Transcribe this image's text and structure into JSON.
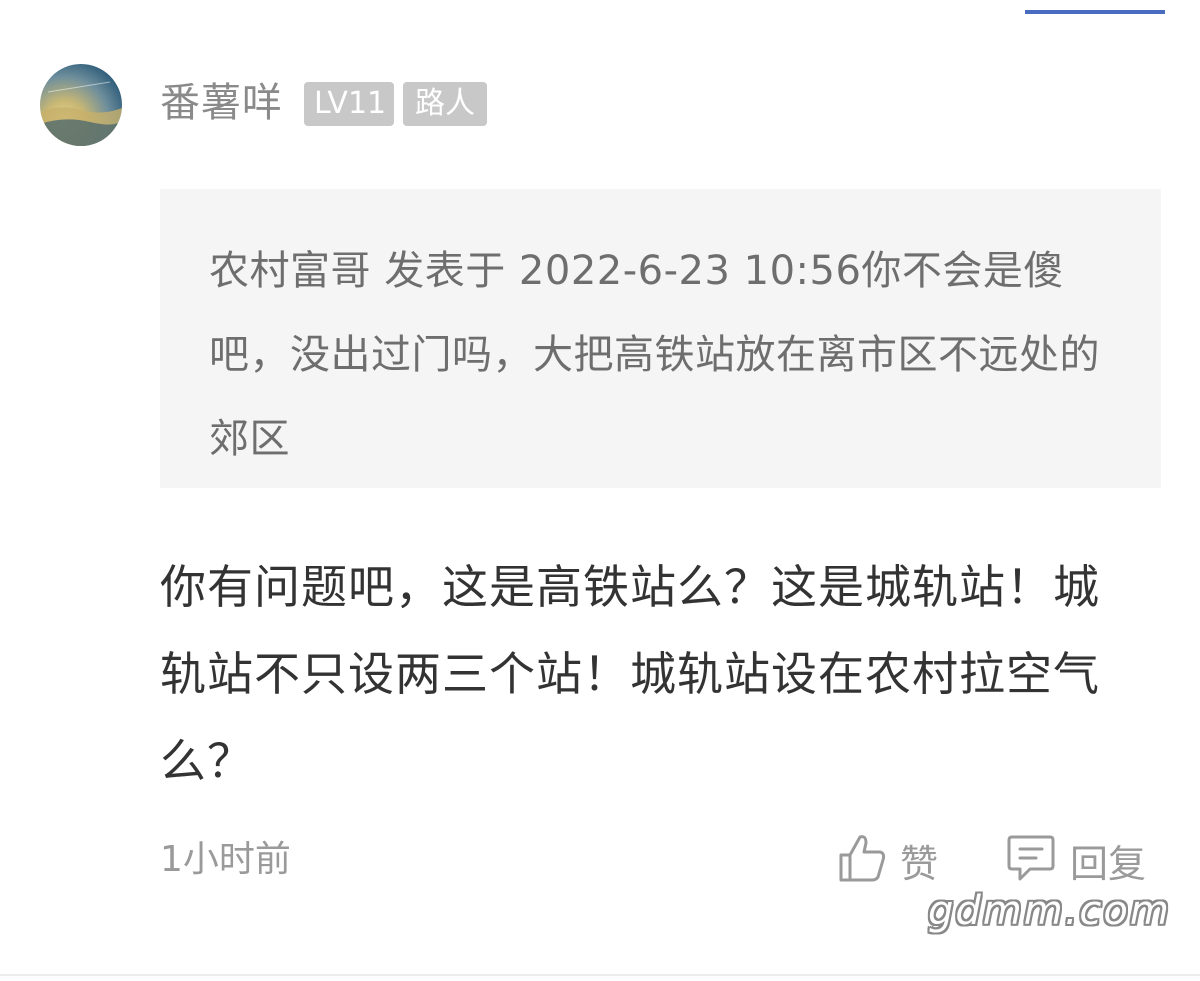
{
  "user": {
    "name": "番薯咩",
    "level_badge": "LV11",
    "role_badge": "路人"
  },
  "quote": {
    "text": "农村富哥 发表于 2022-6-23 10:56你不会是傻吧，没出过门吗，大把高铁站放在离市区不远处的郊区"
  },
  "reply": {
    "text": "你有问题吧，这是高铁站么？这是城轨站！城轨站不只设两三个站！城轨站设在农村拉空气么？"
  },
  "meta": {
    "timestamp": "1小时前"
  },
  "actions": {
    "like_label": "赞",
    "like_icon": "thumbs-up-icon",
    "reply_label": "回复",
    "reply_icon": "comment-icon"
  },
  "watermark": {
    "text": "gdmm.com"
  },
  "colors": {
    "accent": "#4a6cc0",
    "badge_bg": "#c8c8c8",
    "quote_bg": "#f5f5f5",
    "muted_text": "#9a9a9a"
  }
}
